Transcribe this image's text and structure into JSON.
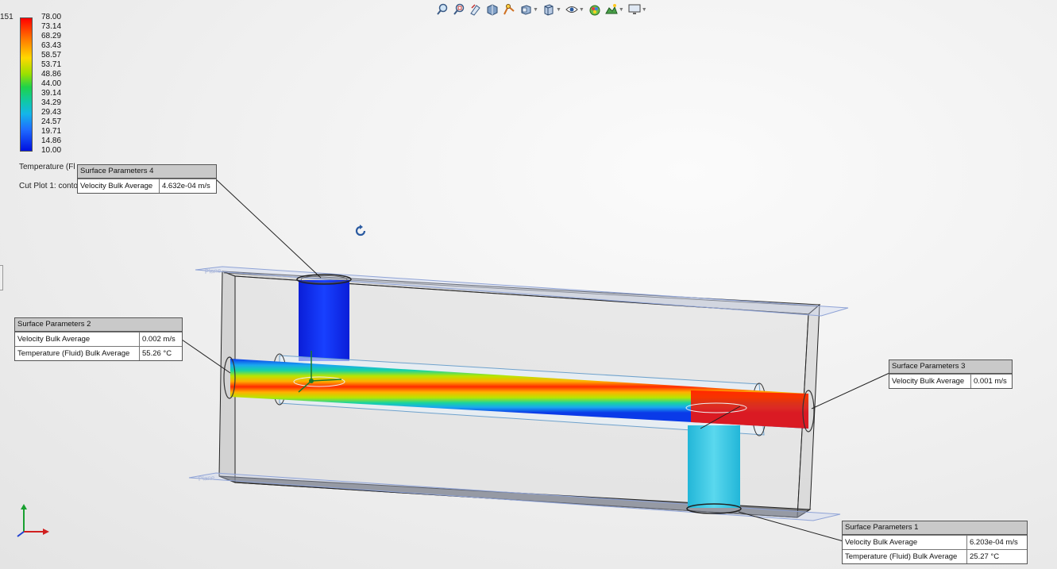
{
  "toolbar": {
    "buttons": [
      {
        "name": "zoom-to-fit",
        "icon": "magnify-fit-icon",
        "dropdown": false
      },
      {
        "name": "zoom-to-area",
        "icon": "magnify-area-icon",
        "dropdown": false
      },
      {
        "name": "previous-view",
        "icon": "previous-view-icon",
        "dropdown": false
      },
      {
        "name": "section-view",
        "icon": "section-view-icon",
        "dropdown": false
      },
      {
        "name": "dynamic-annotation",
        "icon": "dynamic-annotation-icon",
        "dropdown": false
      },
      {
        "name": "view-orientation",
        "icon": "view-orientation-icon",
        "dropdown": true
      },
      {
        "name": "display-style",
        "icon": "display-style-icon",
        "dropdown": true
      },
      {
        "name": "hide-show-items",
        "icon": "eye-icon",
        "dropdown": true
      },
      {
        "name": "edit-appearance",
        "icon": "appearance-icon",
        "dropdown": false
      },
      {
        "name": "apply-scene",
        "icon": "scene-icon",
        "dropdown": true
      },
      {
        "name": "view-settings",
        "icon": "monitor-icon",
        "dropdown": true
      }
    ]
  },
  "legend": {
    "cut_number": "151",
    "values": [
      "78.00",
      "73.14",
      "68.29",
      "63.43",
      "58.57",
      "53.71",
      "48.86",
      "44.00",
      "39.14",
      "34.29",
      "29.43",
      "24.57",
      "19.71",
      "14.86",
      "10.00"
    ],
    "parameter": "Temperature (Fl",
    "cut_plot": "Cut Plot 1: conto"
  },
  "callouts": {
    "sp4": {
      "title": "Surface Parameters 4",
      "rows": [
        {
          "label": "Velocity Bulk Average",
          "value": "4.632e-04 m/s"
        }
      ]
    },
    "sp2": {
      "title": "Surface Parameters 2",
      "rows": [
        {
          "label": "Velocity Bulk Average",
          "value": "0.002 m/s"
        },
        {
          "label": "Temperature (Fluid) Bulk Average",
          "value": "55.26 °C"
        }
      ]
    },
    "sp3": {
      "title": "Surface Parameters 3",
      "rows": [
        {
          "label": "Velocity Bulk Average",
          "value": "0.001 m/s"
        }
      ]
    },
    "sp1": {
      "title": "Surface Parameters 1",
      "rows": [
        {
          "label": "Velocity Bulk Average",
          "value": "6.203e-04 m/s"
        },
        {
          "label": "Temperature (Fluid) Bulk Average",
          "value": "25.27 °C"
        }
      ]
    }
  },
  "model": {
    "plane_label_top": "Plane",
    "plane_label_bottom": "Plane"
  },
  "colors": {
    "hot": "#ff1a00",
    "cold": "#0a2cf0",
    "cool_outlet": "#35c6e0",
    "plane_outline": "#8fa3d6"
  },
  "icons": {
    "rotate": "rotate-view-icon",
    "triad": "xyz-triad-icon"
  }
}
